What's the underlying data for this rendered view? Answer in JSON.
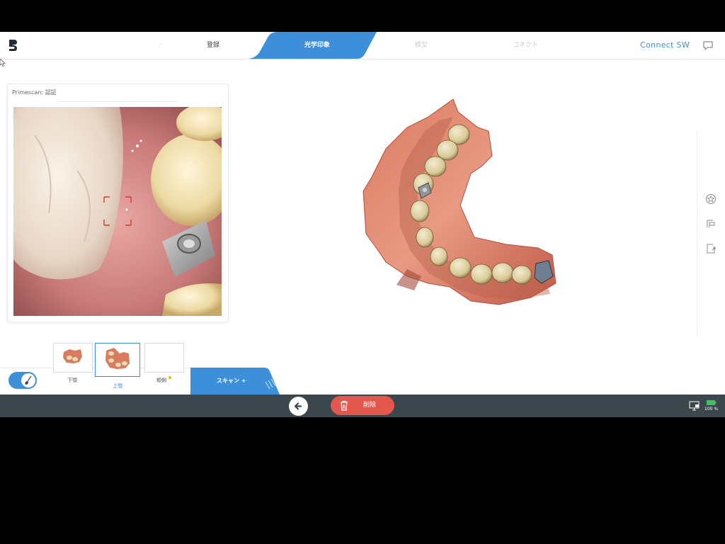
{
  "header": {
    "steps": [
      {
        "label": "",
        "state": "done"
      },
      {
        "label": "登録",
        "state": "done"
      },
      {
        "label": "光学印象",
        "state": "active"
      },
      {
        "label": "模型",
        "state": "future"
      },
      {
        "label": "コネクト",
        "state": "future"
      }
    ],
    "connect_label": "Connect SW",
    "accent_color": "#3d8fd9"
  },
  "camera": {
    "title": "Primescan: 認証"
  },
  "catalog": {
    "items": [
      {
        "label": "下顎",
        "selected": false
      },
      {
        "label": "上顎",
        "selected": true
      },
      {
        "label": "頬側",
        "selected": false,
        "has_indicator": true
      }
    ]
  },
  "scan_tab": {
    "label": "スキャン +"
  },
  "statusbar": {
    "delete_label": "削除",
    "battery_label": "100 %",
    "delete_color": "#e4574c"
  },
  "side_tools": [
    "star-icon",
    "model-icon",
    "export-icon"
  ]
}
